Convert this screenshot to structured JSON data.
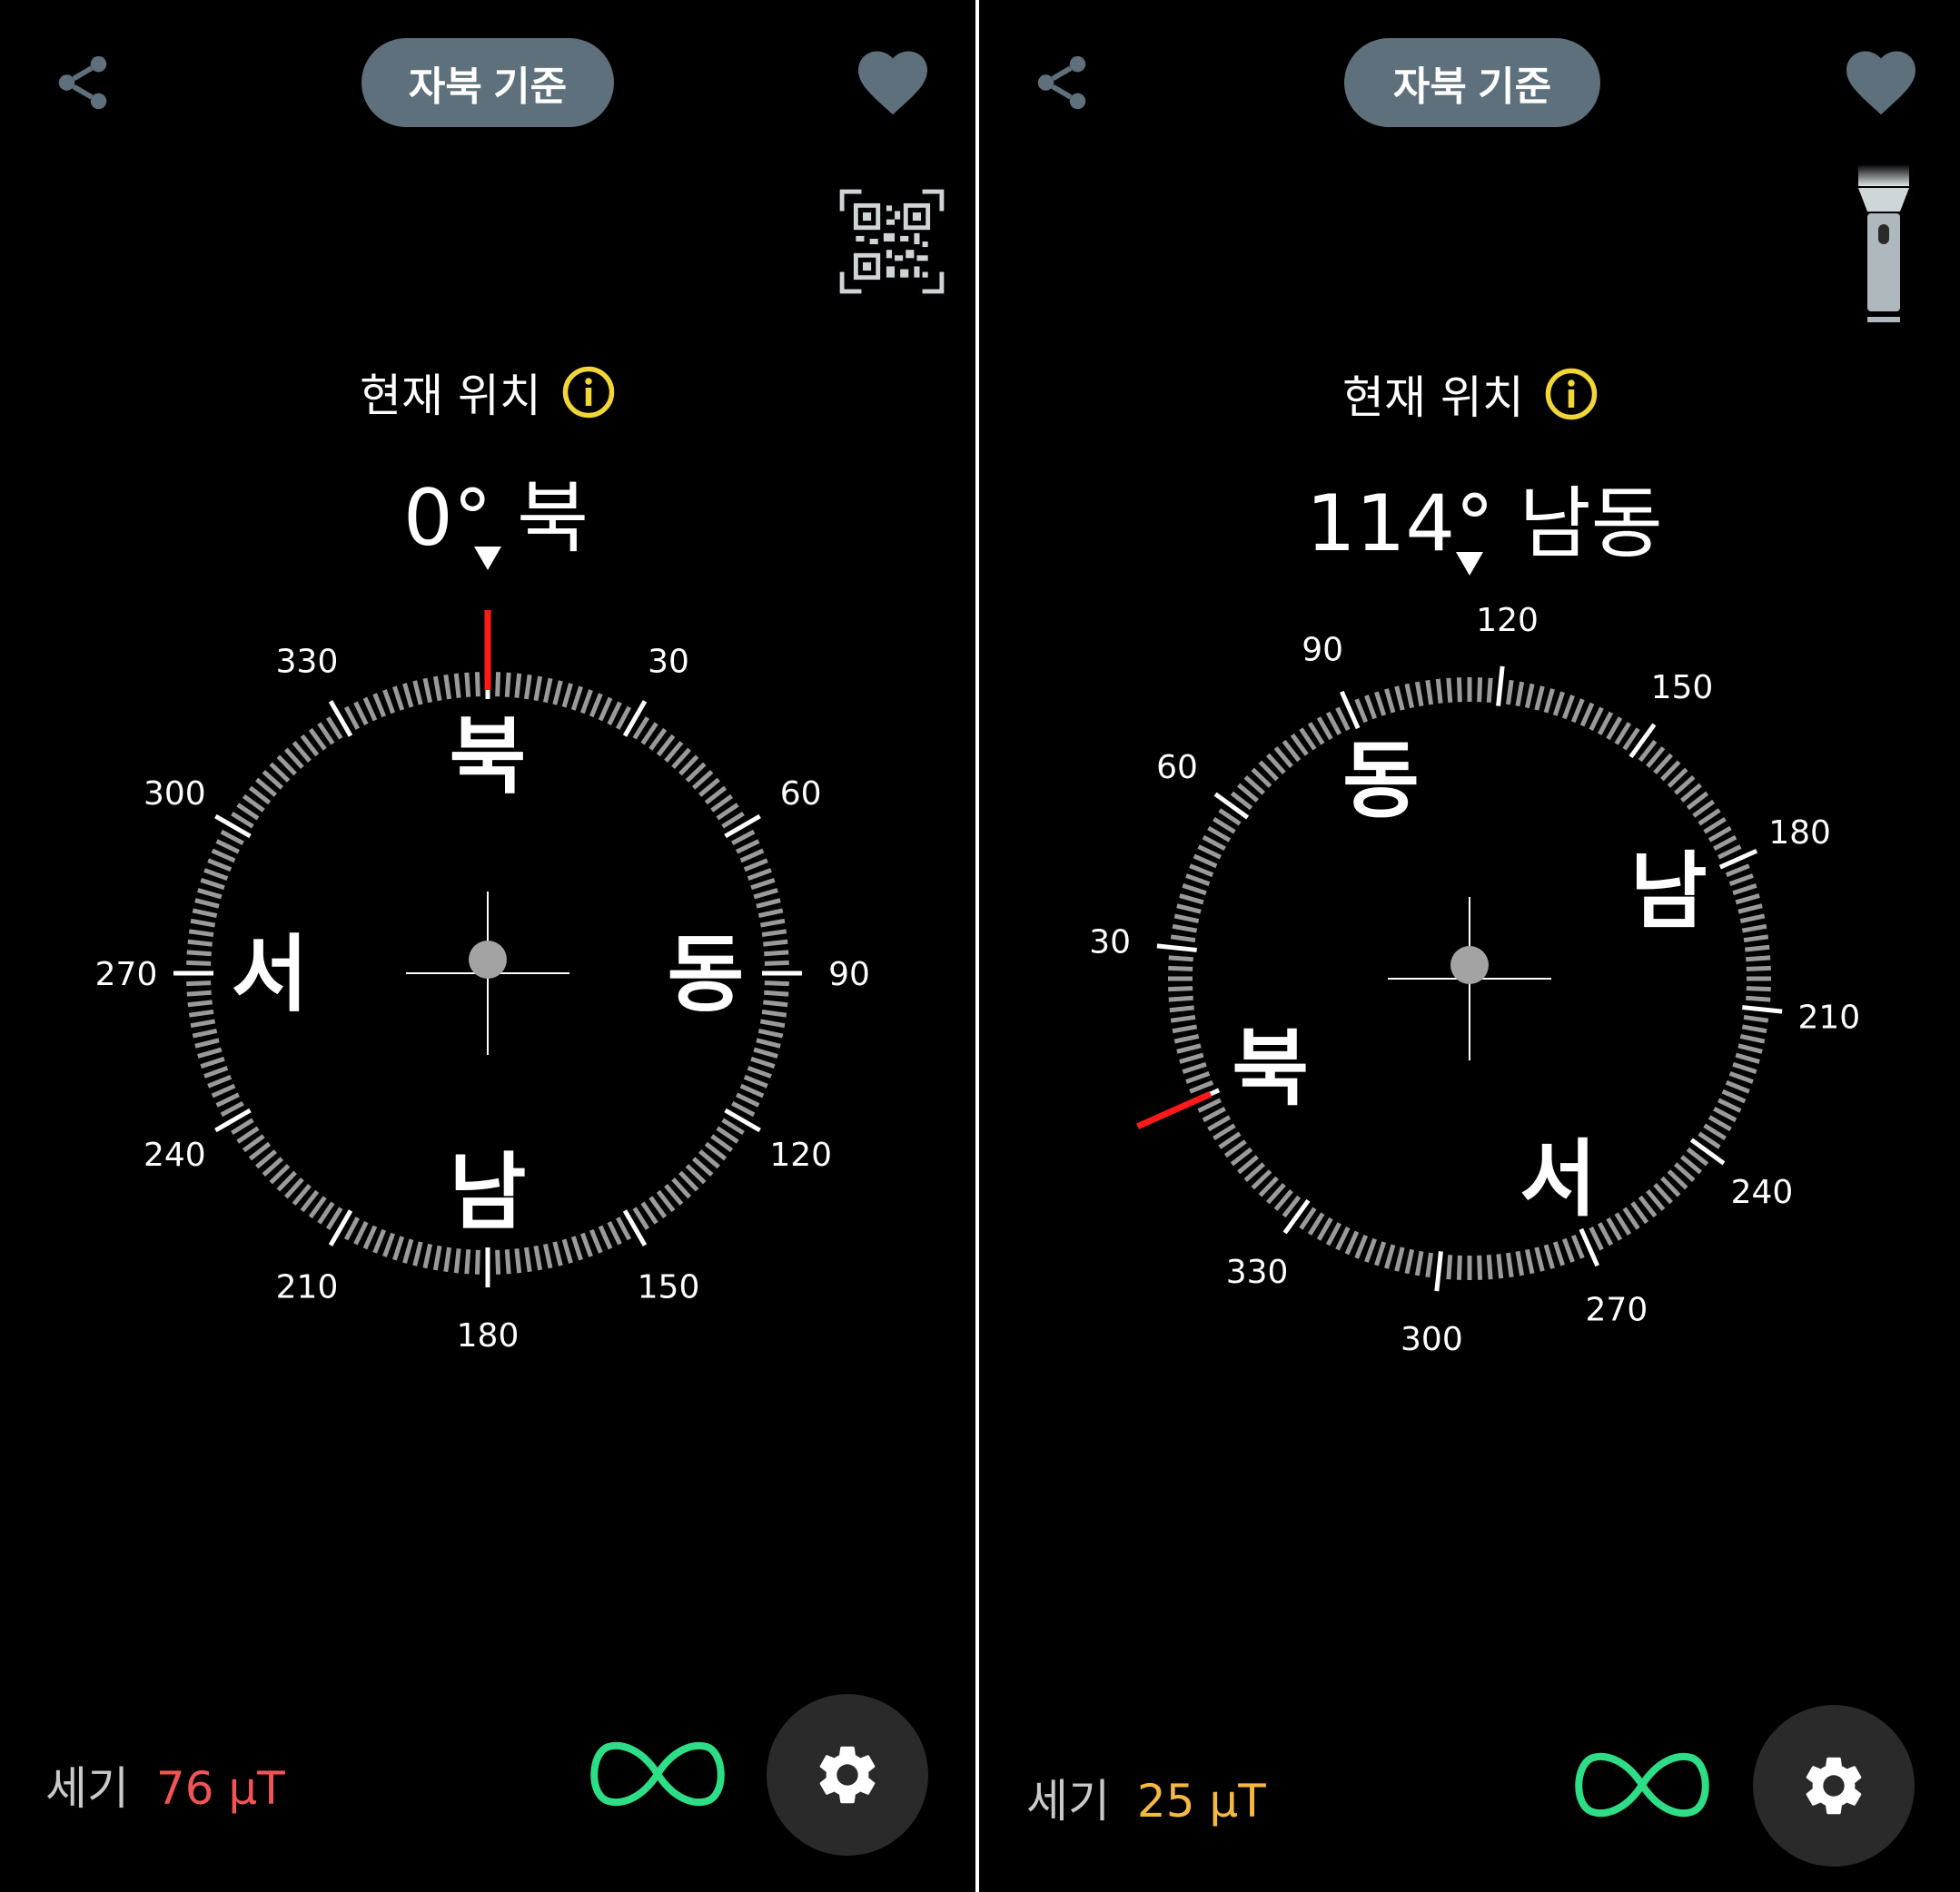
{
  "colors": {
    "accent_red": "#ff1a1a",
    "pill_bg": "#5e707b",
    "icon_gray": "#5e707b",
    "info_yellow": "#f2d637",
    "infinity_green": "#2ede86",
    "strength_high": "#f05454",
    "strength_normal": "#f5b840",
    "settings_bg": "#2a2a2a"
  },
  "panels": [
    {
      "north_reference_label": "자북 기준",
      "tool_icon": "qr-code-icon",
      "location_label": "현재 위치",
      "heading_text": "0° 북",
      "heading_degrees": 0,
      "needle_bearing": 0,
      "cardinals": [
        "북",
        "동",
        "남",
        "서"
      ],
      "degree_labels": [
        "330",
        "30",
        "300",
        "60",
        "270",
        "90",
        "240",
        "120",
        "210",
        "150",
        "180"
      ],
      "strength": {
        "label": "세기",
        "value": "76 μT",
        "status": "high"
      }
    },
    {
      "north_reference_label": "자북 기준",
      "tool_icon": "flashlight-icon",
      "location_label": "현재 위치",
      "heading_text": "114° 남동",
      "heading_degrees": 114,
      "needle_bearing": 0,
      "cardinals": [
        "북",
        "동",
        "남",
        "서"
      ],
      "degree_labels": [
        "90",
        "120",
        "150",
        "60",
        "180",
        "30",
        "210",
        "240",
        "330",
        "270",
        "300"
      ],
      "strength": {
        "label": "세기",
        "value": "25 μT",
        "status": "normal"
      }
    }
  ]
}
